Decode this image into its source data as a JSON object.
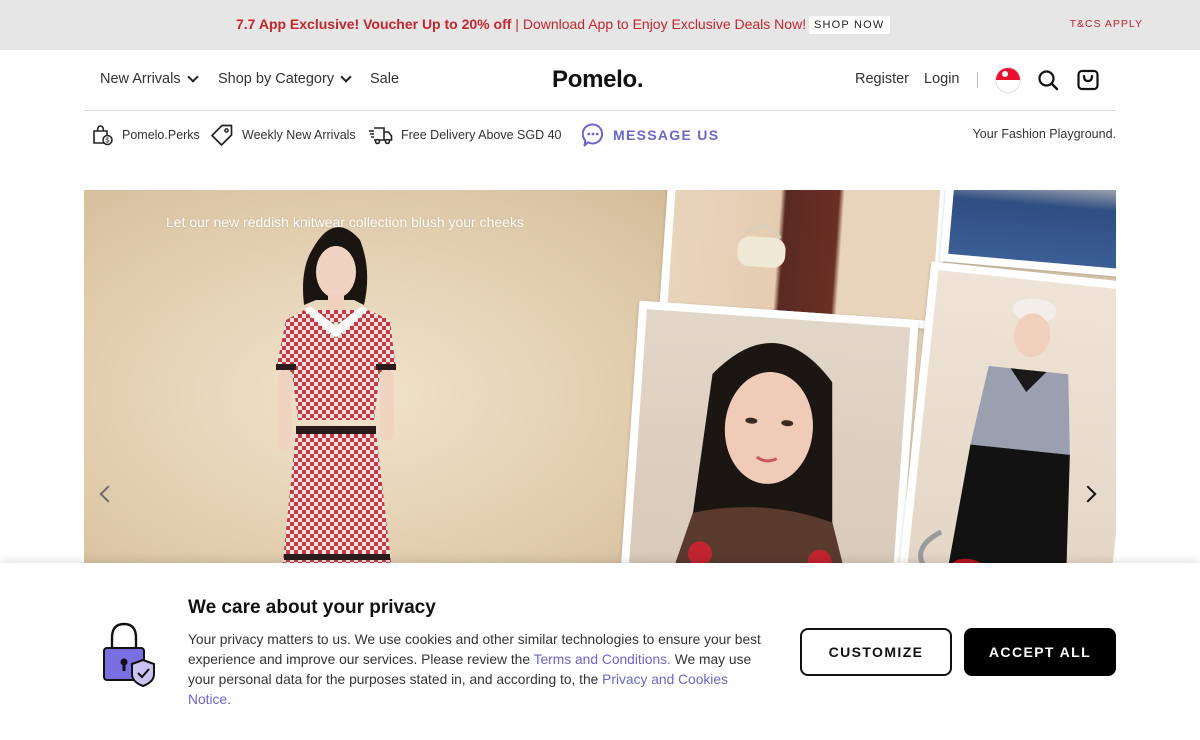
{
  "promo": {
    "strong": "7.7 App Exclusive! Voucher Up to 20% off",
    "sep": " | ",
    "rest": "Download App to Enjoy Exclusive Deals Now!",
    "shop_now": "SHOP NOW",
    "tcs": "T&CS APPLY"
  },
  "header": {
    "nav": [
      "New Arrivals",
      "Shop by Category",
      "Sale"
    ],
    "logo": "Pomelo.",
    "register": "Register",
    "login": "Login"
  },
  "perks": {
    "items": [
      "Pomelo.Perks",
      "Weekly New Arrivals",
      "Free Delivery Above SGD 40"
    ],
    "message": "MESSAGE US",
    "tagline": "Your Fashion Playground."
  },
  "hero": {
    "caption": "Let our new reddish knitwear collection blush your cheeks"
  },
  "cookie": {
    "title": "We care about your privacy",
    "body_1": "Your privacy matters to us. We use cookies and other similar technologies to ensure your best experience and improve our services. Please review the ",
    "link_terms": "Terms and Conditions.",
    "body_2": " We may use your personal data for the purposes stated in, and according to, the ",
    "link_privacy": "Privacy and Cookies Notice.",
    "customize": "CUSTOMIZE",
    "accept": "ACCEPT ALL"
  },
  "colors": {
    "accent": "#6b66c9",
    "promo_red": "#c4262e"
  }
}
